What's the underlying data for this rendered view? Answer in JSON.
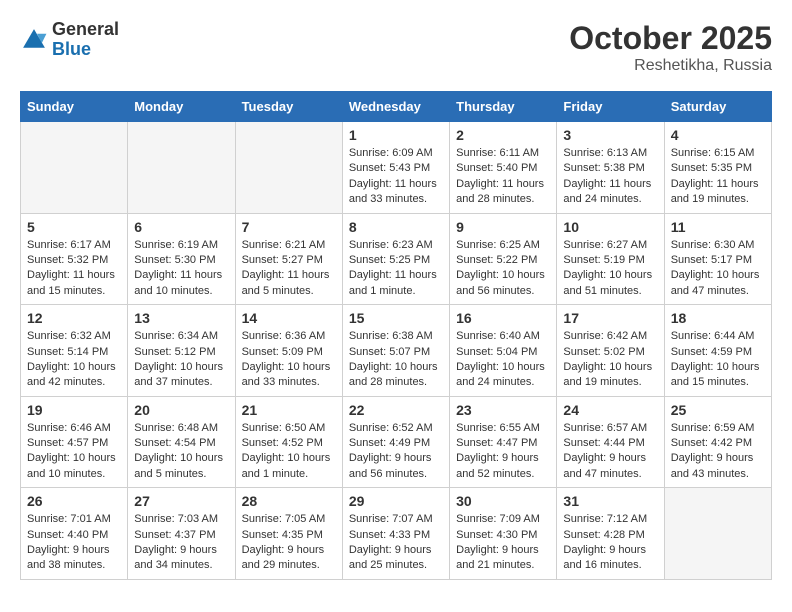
{
  "logo": {
    "general": "General",
    "blue": "Blue"
  },
  "header": {
    "month": "October 2025",
    "location": "Reshetikha, Russia"
  },
  "weekdays": [
    "Sunday",
    "Monday",
    "Tuesday",
    "Wednesday",
    "Thursday",
    "Friday",
    "Saturday"
  ],
  "weeks": [
    [
      {
        "day": "",
        "info": ""
      },
      {
        "day": "",
        "info": ""
      },
      {
        "day": "",
        "info": ""
      },
      {
        "day": "1",
        "info": "Sunrise: 6:09 AM\nSunset: 5:43 PM\nDaylight: 11 hours\nand 33 minutes."
      },
      {
        "day": "2",
        "info": "Sunrise: 6:11 AM\nSunset: 5:40 PM\nDaylight: 11 hours\nand 28 minutes."
      },
      {
        "day": "3",
        "info": "Sunrise: 6:13 AM\nSunset: 5:38 PM\nDaylight: 11 hours\nand 24 minutes."
      },
      {
        "day": "4",
        "info": "Sunrise: 6:15 AM\nSunset: 5:35 PM\nDaylight: 11 hours\nand 19 minutes."
      }
    ],
    [
      {
        "day": "5",
        "info": "Sunrise: 6:17 AM\nSunset: 5:32 PM\nDaylight: 11 hours\nand 15 minutes."
      },
      {
        "day": "6",
        "info": "Sunrise: 6:19 AM\nSunset: 5:30 PM\nDaylight: 11 hours\nand 10 minutes."
      },
      {
        "day": "7",
        "info": "Sunrise: 6:21 AM\nSunset: 5:27 PM\nDaylight: 11 hours\nand 5 minutes."
      },
      {
        "day": "8",
        "info": "Sunrise: 6:23 AM\nSunset: 5:25 PM\nDaylight: 11 hours\nand 1 minute."
      },
      {
        "day": "9",
        "info": "Sunrise: 6:25 AM\nSunset: 5:22 PM\nDaylight: 10 hours\nand 56 minutes."
      },
      {
        "day": "10",
        "info": "Sunrise: 6:27 AM\nSunset: 5:19 PM\nDaylight: 10 hours\nand 51 minutes."
      },
      {
        "day": "11",
        "info": "Sunrise: 6:30 AM\nSunset: 5:17 PM\nDaylight: 10 hours\nand 47 minutes."
      }
    ],
    [
      {
        "day": "12",
        "info": "Sunrise: 6:32 AM\nSunset: 5:14 PM\nDaylight: 10 hours\nand 42 minutes."
      },
      {
        "day": "13",
        "info": "Sunrise: 6:34 AM\nSunset: 5:12 PM\nDaylight: 10 hours\nand 37 minutes."
      },
      {
        "day": "14",
        "info": "Sunrise: 6:36 AM\nSunset: 5:09 PM\nDaylight: 10 hours\nand 33 minutes."
      },
      {
        "day": "15",
        "info": "Sunrise: 6:38 AM\nSunset: 5:07 PM\nDaylight: 10 hours\nand 28 minutes."
      },
      {
        "day": "16",
        "info": "Sunrise: 6:40 AM\nSunset: 5:04 PM\nDaylight: 10 hours\nand 24 minutes."
      },
      {
        "day": "17",
        "info": "Sunrise: 6:42 AM\nSunset: 5:02 PM\nDaylight: 10 hours\nand 19 minutes."
      },
      {
        "day": "18",
        "info": "Sunrise: 6:44 AM\nSunset: 4:59 PM\nDaylight: 10 hours\nand 15 minutes."
      }
    ],
    [
      {
        "day": "19",
        "info": "Sunrise: 6:46 AM\nSunset: 4:57 PM\nDaylight: 10 hours\nand 10 minutes."
      },
      {
        "day": "20",
        "info": "Sunrise: 6:48 AM\nSunset: 4:54 PM\nDaylight: 10 hours\nand 5 minutes."
      },
      {
        "day": "21",
        "info": "Sunrise: 6:50 AM\nSunset: 4:52 PM\nDaylight: 10 hours\nand 1 minute."
      },
      {
        "day": "22",
        "info": "Sunrise: 6:52 AM\nSunset: 4:49 PM\nDaylight: 9 hours\nand 56 minutes."
      },
      {
        "day": "23",
        "info": "Sunrise: 6:55 AM\nSunset: 4:47 PM\nDaylight: 9 hours\nand 52 minutes."
      },
      {
        "day": "24",
        "info": "Sunrise: 6:57 AM\nSunset: 4:44 PM\nDaylight: 9 hours\nand 47 minutes."
      },
      {
        "day": "25",
        "info": "Sunrise: 6:59 AM\nSunset: 4:42 PM\nDaylight: 9 hours\nand 43 minutes."
      }
    ],
    [
      {
        "day": "26",
        "info": "Sunrise: 7:01 AM\nSunset: 4:40 PM\nDaylight: 9 hours\nand 38 minutes."
      },
      {
        "day": "27",
        "info": "Sunrise: 7:03 AM\nSunset: 4:37 PM\nDaylight: 9 hours\nand 34 minutes."
      },
      {
        "day": "28",
        "info": "Sunrise: 7:05 AM\nSunset: 4:35 PM\nDaylight: 9 hours\nand 29 minutes."
      },
      {
        "day": "29",
        "info": "Sunrise: 7:07 AM\nSunset: 4:33 PM\nDaylight: 9 hours\nand 25 minutes."
      },
      {
        "day": "30",
        "info": "Sunrise: 7:09 AM\nSunset: 4:30 PM\nDaylight: 9 hours\nand 21 minutes."
      },
      {
        "day": "31",
        "info": "Sunrise: 7:12 AM\nSunset: 4:28 PM\nDaylight: 9 hours\nand 16 minutes."
      },
      {
        "day": "",
        "info": ""
      }
    ]
  ]
}
